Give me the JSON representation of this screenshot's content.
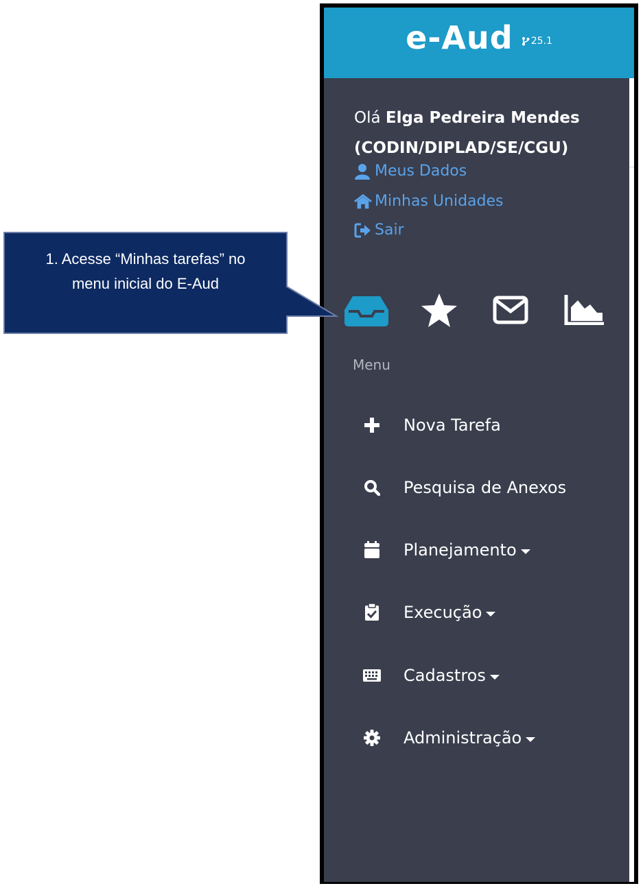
{
  "app": {
    "title": "e-Aud",
    "version": "25.1"
  },
  "user": {
    "greeting_prefix": "Olá",
    "name": "Elga Pedreira Mendes",
    "unit": "(CODIN/DIPLAD/SE/CGU)",
    "links": [
      {
        "label": "Meus Dados",
        "icon": "user-icon"
      },
      {
        "label": "Minhas Unidades",
        "icon": "home-icon"
      },
      {
        "label": "Sair",
        "icon": "sign-out-icon"
      }
    ]
  },
  "quick_icons": [
    {
      "icon": "inbox-icon",
      "color": "#1d9bc9"
    },
    {
      "icon": "star-icon",
      "color": "#ffffff"
    },
    {
      "icon": "envelope-icon",
      "color": "#ffffff"
    },
    {
      "icon": "area-chart-icon",
      "color": "#ffffff"
    }
  ],
  "menu": {
    "heading": "Menu",
    "items": [
      {
        "label": "Nova Tarefa",
        "icon": "plus-icon",
        "dropdown": false
      },
      {
        "label": "Pesquisa de Anexos",
        "icon": "search-icon",
        "dropdown": false
      },
      {
        "label": "Planejamento",
        "icon": "calendar-icon",
        "dropdown": true
      },
      {
        "label": "Execução",
        "icon": "clipboard-check-icon",
        "dropdown": true
      },
      {
        "label": "Cadastros",
        "icon": "keyboard-icon",
        "dropdown": true
      },
      {
        "label": "Administração",
        "icon": "gear-icon",
        "dropdown": true
      }
    ]
  },
  "callout": {
    "line1": "1. Acesse “Minhas tarefas” no",
    "line2": "menu inicial do E-Aud"
  },
  "colors": {
    "brand": "#1d9bc9",
    "sidebar": "#3a3e4d",
    "link": "#5aa3ea",
    "callout_fill": "#0d2a62"
  }
}
